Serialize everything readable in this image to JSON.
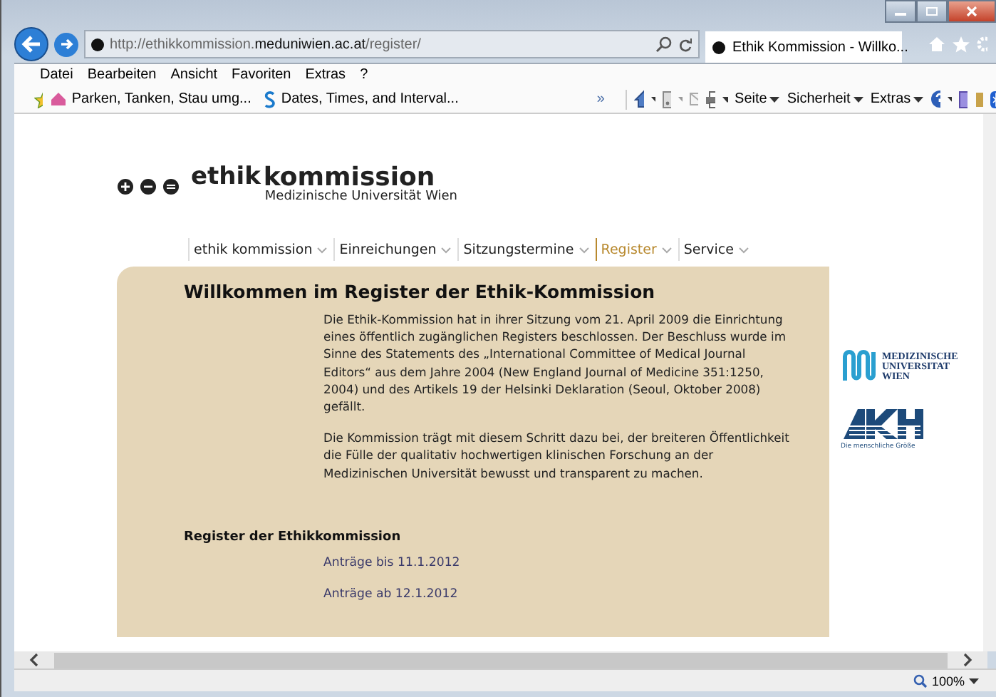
{
  "browser": {
    "url_prefix": "http://ethikkommission.",
    "url_domain": "meduniwien.ac.at",
    "url_path": "/register/",
    "tab_title": "Ethik Kommission - Willko...",
    "menu": [
      "Datei",
      "Bearbeiten",
      "Ansicht",
      "Favoriten",
      "Extras",
      "?"
    ],
    "favorites": [
      "Parken, Tanken, Stau umg...",
      "Dates, Times, and Interval..."
    ],
    "chevron": "»",
    "commands": [
      "Seite",
      "Sicherheit",
      "Extras"
    ],
    "zoom": "100%"
  },
  "logo": {
    "word1": "ethik",
    "word2": "kommission",
    "subtitle": "Medizinische Universität Wien"
  },
  "nav": [
    {
      "label": "ethik kommission",
      "selected": false
    },
    {
      "label": "Einreichungen",
      "selected": false
    },
    {
      "label": "Sitzungstermine",
      "selected": false
    },
    {
      "label": "Register",
      "selected": true
    },
    {
      "label": "Service",
      "selected": false
    }
  ],
  "heading": "Willkommen im Register der Ethik-Kommission",
  "paragraphs": [
    "Die Ethik-Kommission hat in ihrer Sitzung vom 21. April 2009 die Einrichtung eines öffentlich zugänglichen Registers beschlossen. Der Beschluss wurde im Sinne des Statements des „International Committee of Medical Journal Editors“ aus dem Jahre 2004 (New England Journal of Medicine 351:1250, 2004) und des Artikels 19 der Helsinki Deklaration (Seoul, Oktober 2008) gefällt.",
    "Die Kommission trägt mit diesem Schritt dazu bei, der breiteren Öffentlichkeit die Fülle der qualitativ hochwertigen klinischen Forschung an der Medizinischen Universität bewusst und transparent zu machen."
  ],
  "register_heading": "Register der Ethikkommission",
  "register_links": [
    "Anträge bis 11.1.2012",
    "Anträge ab 12.1.2012"
  ],
  "sidebar_logos": {
    "meduni": "MEDIZINISCHE UNIVERSITAT WIEN",
    "akh": "Die menschliche Größe"
  }
}
